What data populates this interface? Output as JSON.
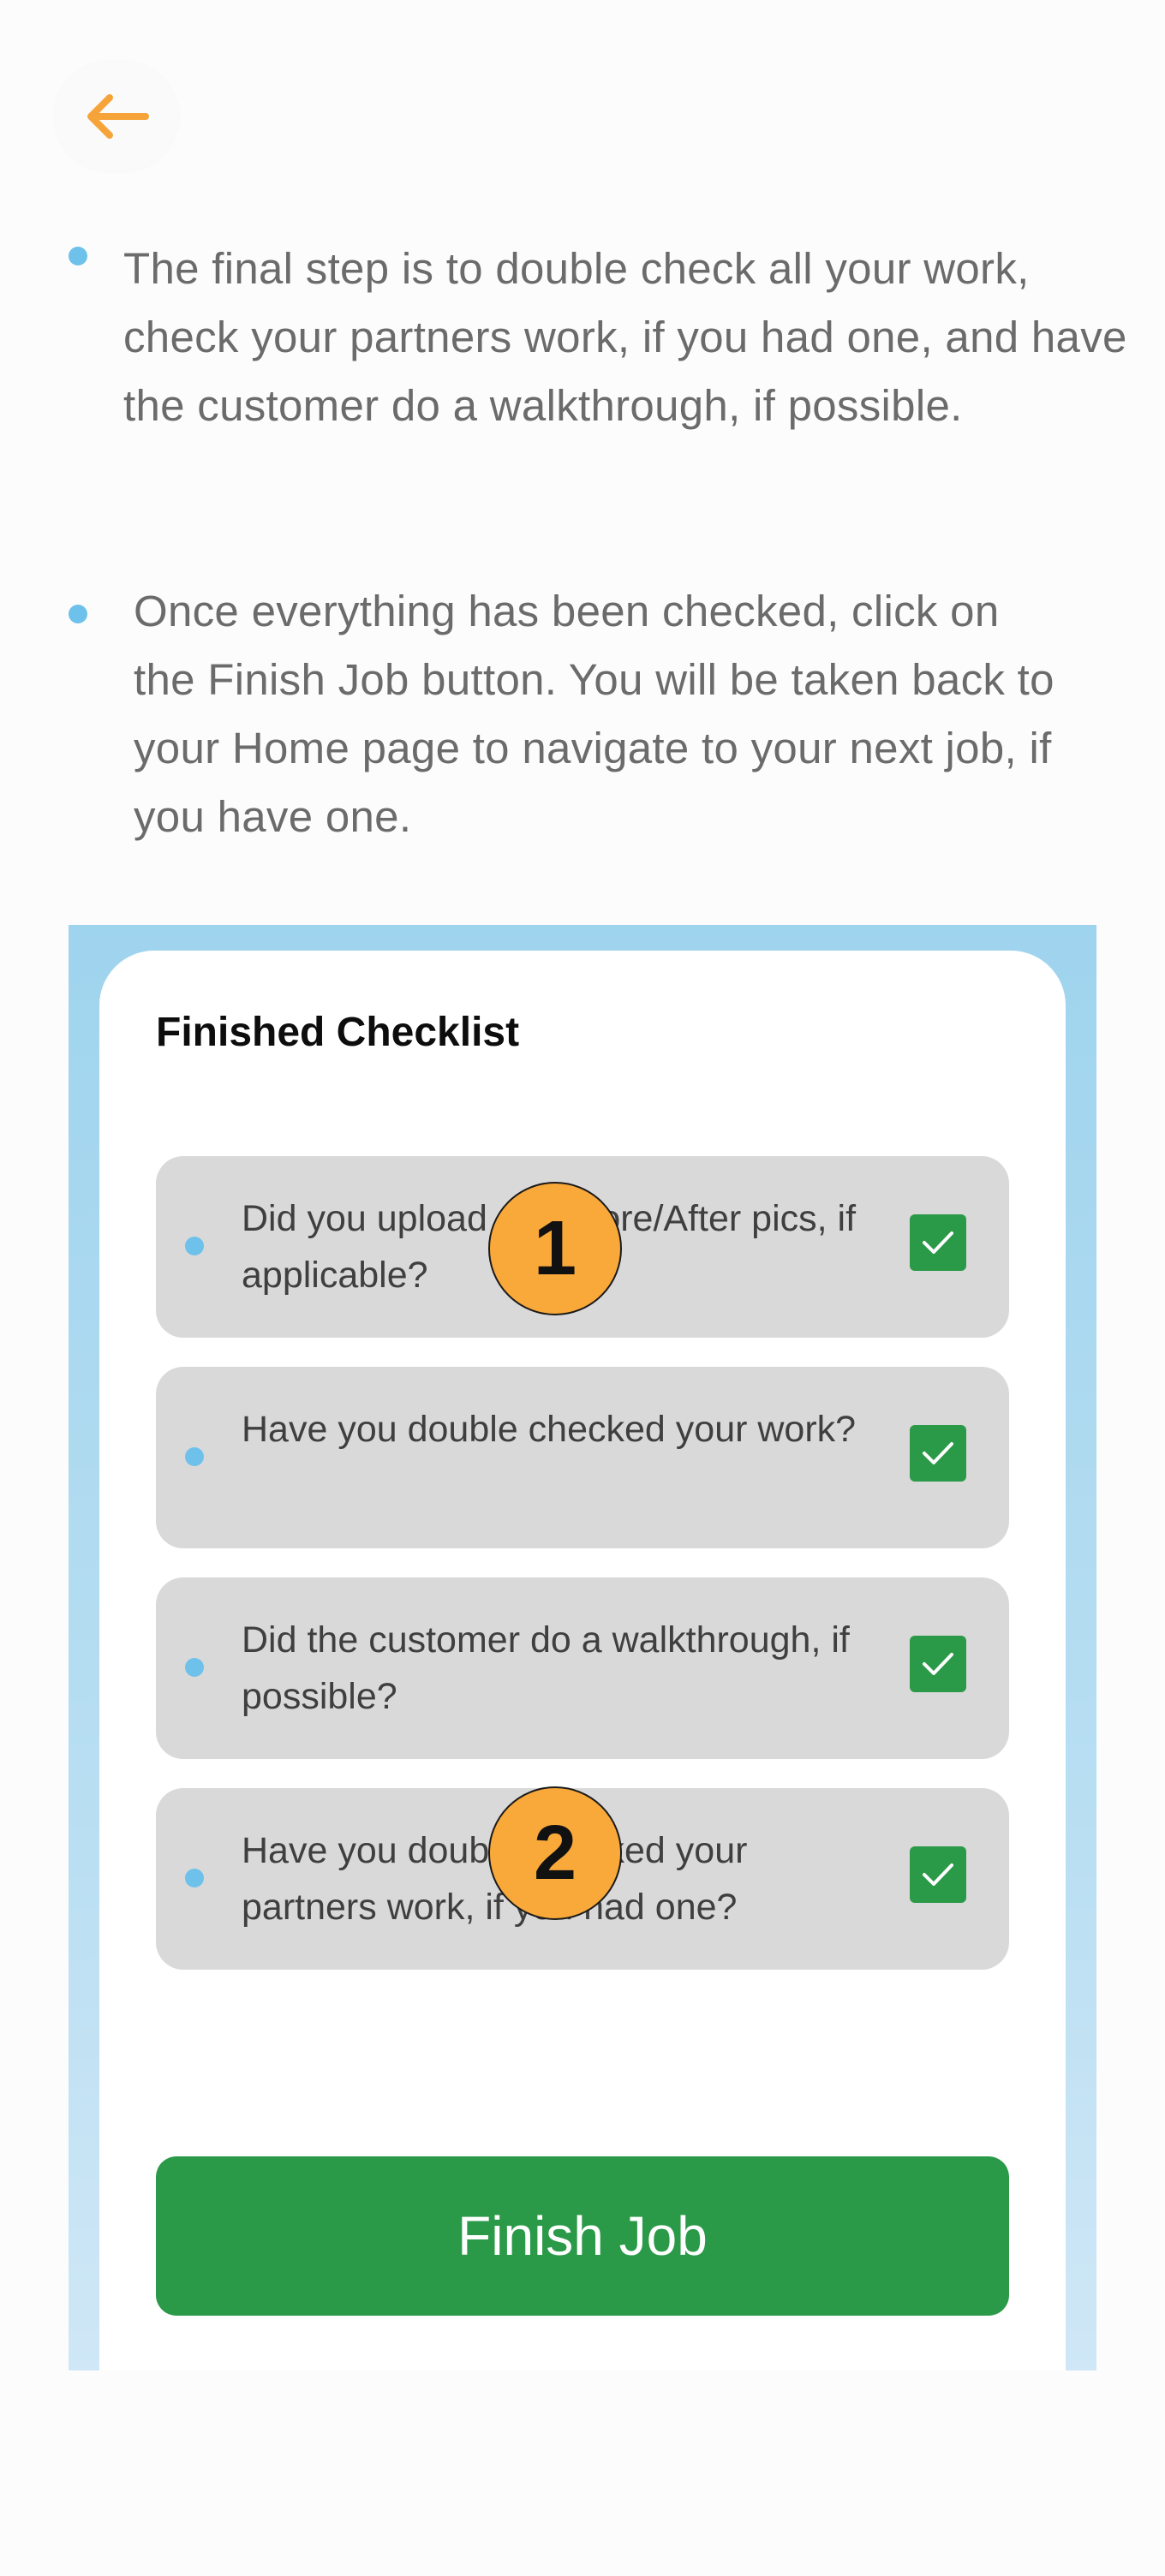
{
  "header": {
    "back_icon": "arrow-left-icon",
    "accent_color": "#f6a43a"
  },
  "instructions": [
    "The final step is to double check all your work, check your partners work, if you had one, and have the customer do a walkthrough, if possible.",
    "Once everything has been checked, click on the Finish Job button. You will be taken back to your Home page to navigate to your next job, if you have one."
  ],
  "checklist": {
    "title": "Finished Checklist",
    "items": [
      {
        "label": "Did you upload all Before/After pics, if applicable?",
        "checked": true
      },
      {
        "label": "Have you double checked your work?",
        "checked": true
      },
      {
        "label": "Did the customer do a walkthrough, if possible?",
        "checked": true
      },
      {
        "label": "Have you double checked your partners work, if you had one?",
        "checked": true
      }
    ],
    "check_icon": "checkmark-icon",
    "check_color": "#2a9a48"
  },
  "finish_button": {
    "label": "Finish Job",
    "color": "#2a9a48"
  },
  "markers": [
    "1",
    "2"
  ]
}
